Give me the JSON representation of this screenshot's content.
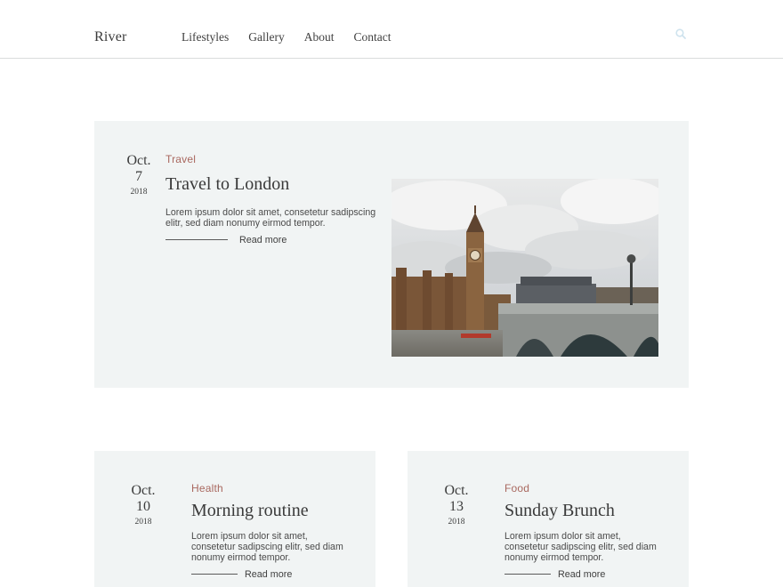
{
  "header": {
    "logo": "River",
    "nav": [
      "Lifestyles",
      "Gallery",
      "About",
      "Contact"
    ],
    "search_icon": "search-icon"
  },
  "featured": {
    "date": {
      "month": "Oct.",
      "day": "7",
      "year": "2018"
    },
    "category": "Travel",
    "title": "Travel to London",
    "excerpt_line1": "Lorem ipsum dolor sit amet, consetetur sadipscing",
    "excerpt_line2": "elitr, sed diam nonumy eirmod tempor.",
    "read_more": "Read more"
  },
  "posts": [
    {
      "date": {
        "month": "Oct.",
        "day": "10",
        "year": "2018"
      },
      "category": "Health",
      "title": "Morning routine",
      "excerpt_line1": "Lorem ipsum dolor sit amet,",
      "excerpt_line2": "consetetur sadipscing elitr, sed diam",
      "excerpt_line3": "nonumy eirmod tempor.",
      "read_more": "Read more"
    },
    {
      "date": {
        "month": "Oct.",
        "day": "13",
        "year": "2018"
      },
      "category": "Food",
      "title": "Sunday Brunch",
      "excerpt_line1": "Lorem ipsum dolor sit amet,",
      "excerpt_line2": "consetetur sadipscing elitr, sed diam",
      "excerpt_line3": "nonumy eirmod tempor.",
      "read_more": "Read more"
    }
  ],
  "colors": {
    "accent": "#a9685f",
    "card_bg": "#f1f4f4",
    "text": "#3a3a3a",
    "search_icon": "#cfe3ee"
  }
}
